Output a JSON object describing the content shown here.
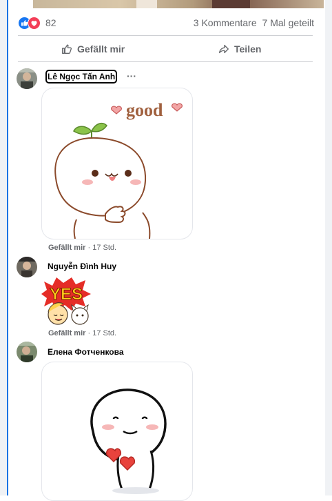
{
  "post_stats": {
    "reaction_count": "82",
    "comments": "3 Kommentare",
    "shares": "7 Mal geteilt",
    "reactions": [
      "like-icon",
      "love-icon"
    ]
  },
  "actions": {
    "like_label": "Gefällt mir",
    "share_label": "Teilen"
  },
  "comments": [
    {
      "author": "Lê Ngọc Tấn Anh",
      "sticker_text": "good",
      "like_label": "Gefällt mir",
      "separator": "·",
      "time": "17 Std."
    },
    {
      "author": "Nguyễn Đình Huy",
      "sticker_text": "YES",
      "like_label": "Gefällt mir",
      "separator": "·",
      "time": "17 Std."
    },
    {
      "author": "Елена Фотченкова",
      "sticker_text": "",
      "like_label": "",
      "separator": "",
      "time": ""
    }
  ],
  "colors": {
    "accent": "#1877f2",
    "love": "#f33e58",
    "muted": "#65676b",
    "focus_bar": "#1b74e4"
  }
}
